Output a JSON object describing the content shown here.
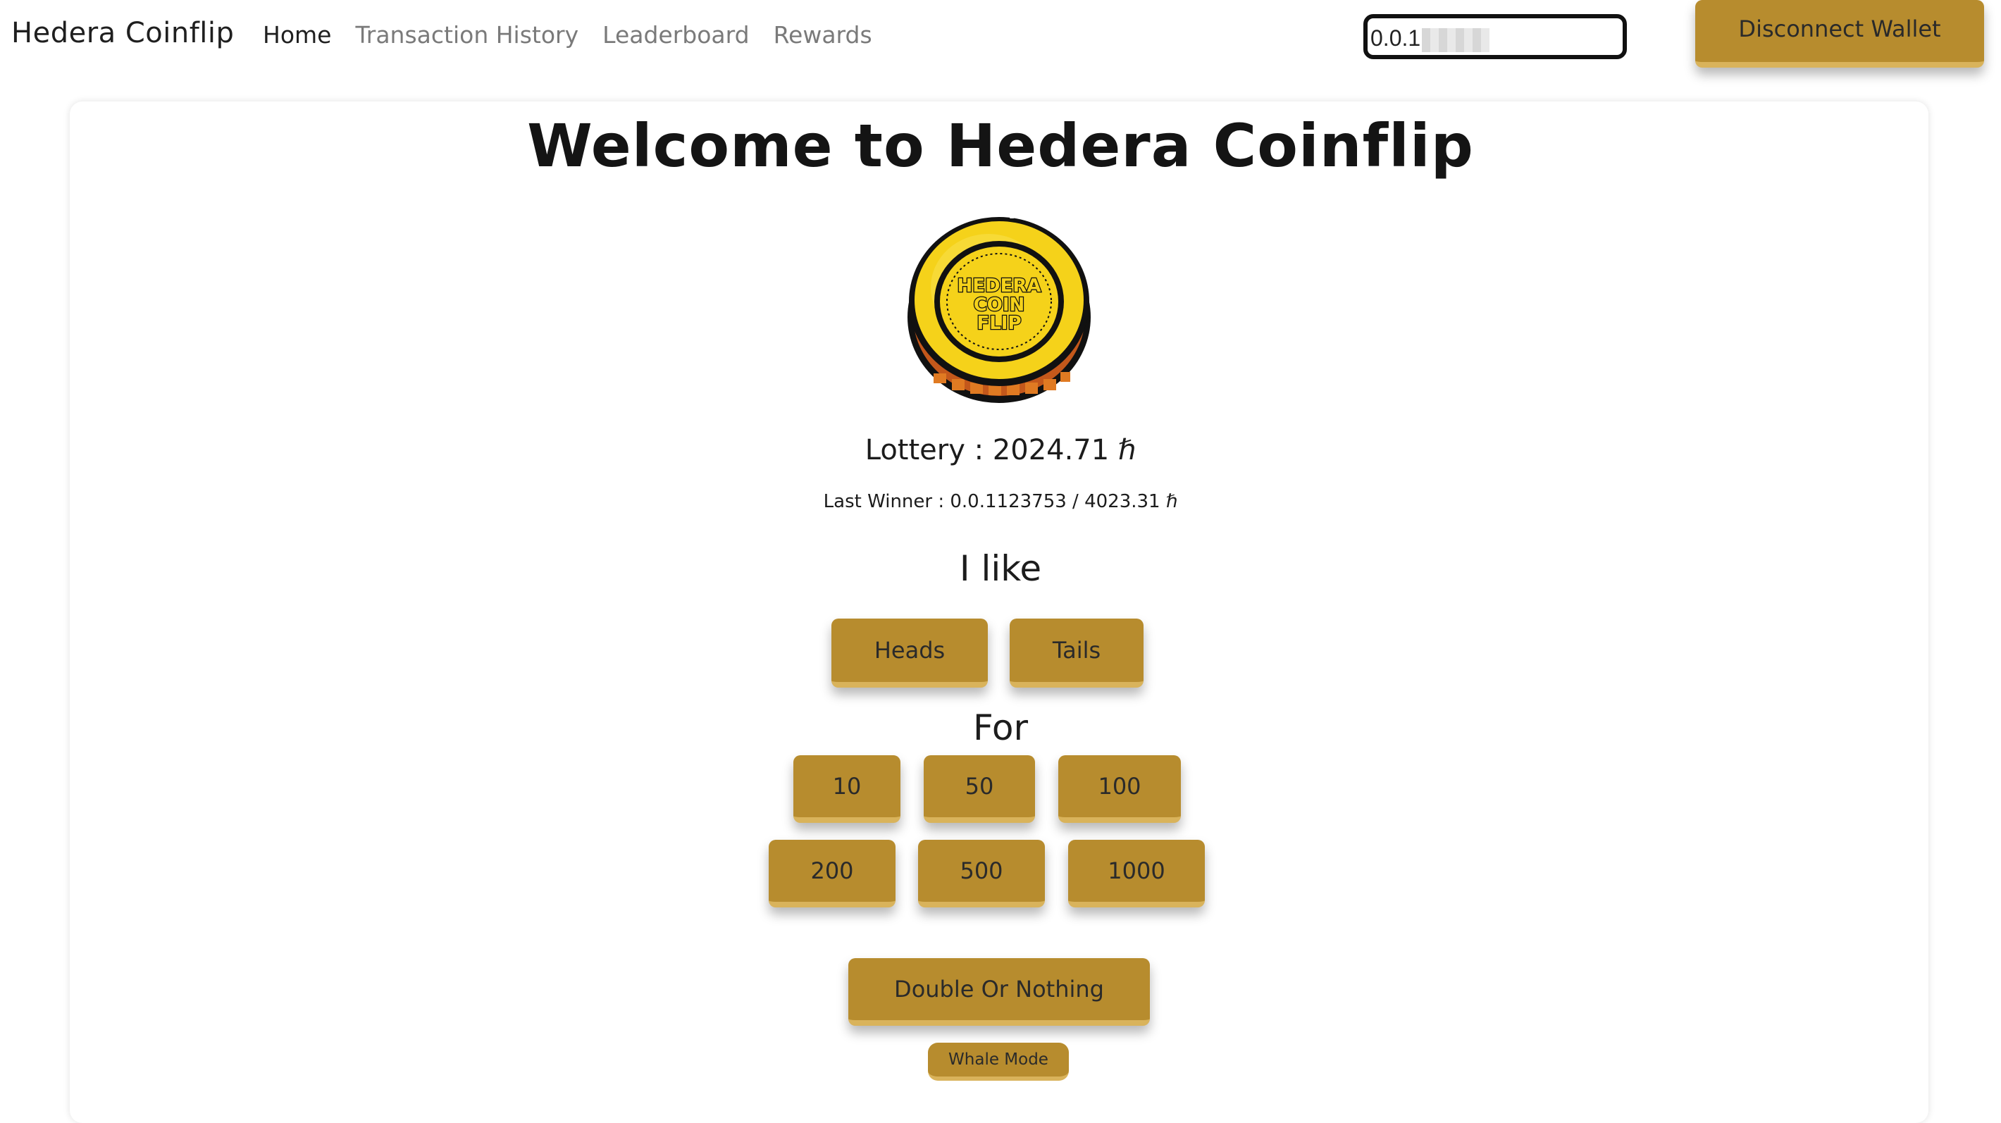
{
  "nav": {
    "brand": "Hedera Coinflip",
    "links": [
      {
        "label": "Home",
        "active": true
      },
      {
        "label": "Transaction History",
        "active": false
      },
      {
        "label": "Leaderboard",
        "active": false
      },
      {
        "label": "Rewards",
        "active": false
      }
    ],
    "wallet_id_visible": "0.0.1",
    "disconnect_label": "Disconnect Wallet"
  },
  "main": {
    "title": "Welcome to Hedera Coinflip",
    "coin_text": [
      "HEDERA",
      "COIN",
      "FLIP"
    ],
    "lottery": "Lottery : 2024.71 ℏ",
    "last_winner": "Last Winner : 0.0.1123753 / 4023.31 ℏ",
    "like_label": "I like",
    "choices": [
      "Heads",
      "Tails"
    ],
    "for_label": "For",
    "amounts": [
      "10",
      "50",
      "100",
      "200",
      "500",
      "1000"
    ],
    "double_label": "Double Or Nothing",
    "whale_label": "Whale Mode"
  },
  "colors": {
    "gold_button": "#b78c2e",
    "gold_button_edge": "#d9b35b",
    "coin_yellow": "#f5d21a",
    "coin_edge": "#c4581b"
  }
}
